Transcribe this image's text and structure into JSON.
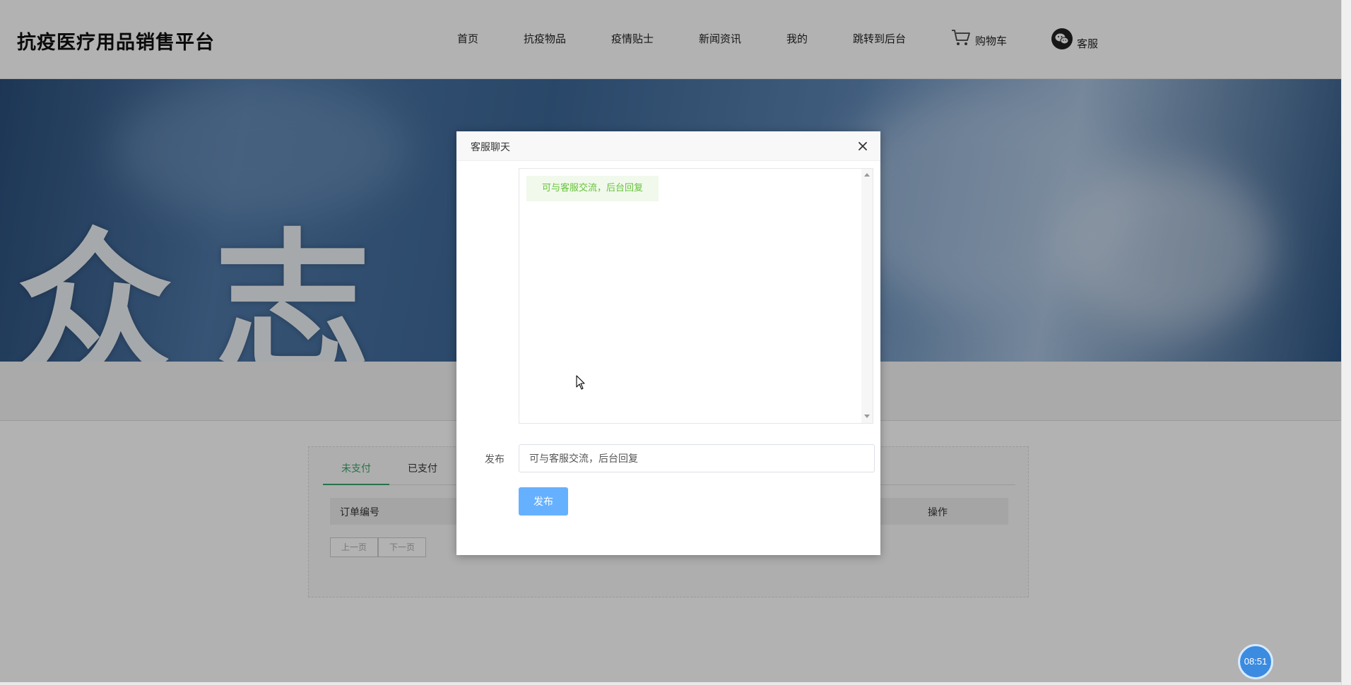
{
  "header": {
    "logo": "抗疫医疗用品销售平台",
    "nav": [
      {
        "label": "首页"
      },
      {
        "label": "抗疫物品"
      },
      {
        "label": "疫情贴士"
      },
      {
        "label": "新闻资讯"
      },
      {
        "label": "我的"
      },
      {
        "label": "跳转到后台"
      }
    ],
    "cart": {
      "label": "购物车",
      "icon": "cart-icon"
    },
    "service": {
      "label": "客服",
      "icon": "wechat-icon"
    }
  },
  "banner": {
    "text": "众志"
  },
  "orders": {
    "tabs": [
      {
        "label": "未支付",
        "active": true
      },
      {
        "label": "已支付",
        "active": false
      }
    ],
    "columns": {
      "order_no": "订单编号",
      "actions": "操作"
    },
    "pager": {
      "prev": "上一页",
      "next": "下一页"
    }
  },
  "modal": {
    "title": "客服聊天",
    "close_icon": "close-icon",
    "messages": [
      {
        "text": "可与客服交流，后台回复"
      }
    ],
    "form_label": "发布",
    "input_value": "可与客服交流，后台回复",
    "submit_label": "发布"
  },
  "clock": {
    "time": "08:51"
  },
  "colors": {
    "accent_green": "#3aa46a",
    "message_bg": "#f0f9eb",
    "message_text": "#67c23a",
    "submit_bg": "#66b1ff",
    "clock_bg": "#3b8be0"
  }
}
